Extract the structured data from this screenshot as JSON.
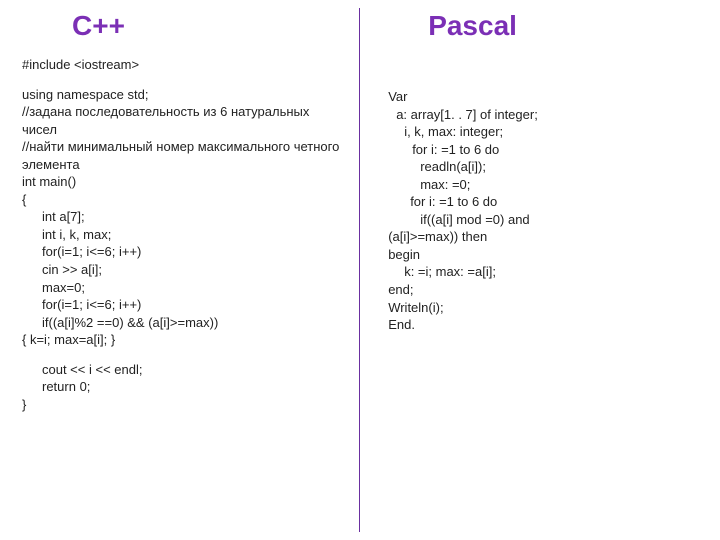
{
  "left": {
    "title": "С++",
    "include": "#include <iostream>",
    "ns": "using namespace std;",
    "c1": "//задана последовательность из 6 натуральных чисел",
    "c2": "//найти минимальный  номер максимального четного элемента",
    "l_main": "int main()",
    "l_ob": "{",
    "l_arr": "int a[7];",
    "l_vars": "int i, k, max;",
    "l_for1": "for(i=1; i<=6; i++)",
    "l_cin": "cin >> a[i];",
    "l_max0": "max=0;",
    "l_for2": "for(i=1; i<=6; i++)",
    "l_if": "if((a[i]%2 ==0) && (a[i]>=max))",
    "l_body": "{ k=i; max=a[i]; }",
    "l_cout": "cout << i << endl;",
    "l_ret": "return 0;",
    "l_cb": "}"
  },
  "right": {
    "title": "Pascal",
    "l_var": "Var",
    "l_a": "a: array[1. . 7] of integer;",
    "l_ikm": "i, k, max: integer;",
    "l_for1": "for i: =1 to 6 do",
    "l_read": "readln(a[i]);",
    "l_max0": "max: =0;",
    "l_for2": "for i: =1 to 6 do",
    "l_if1": "if((a[i] mod =0) and",
    "l_if2": "(a[i]>=max)) then",
    "l_begin": "begin",
    "l_body": "k: =i; max: =a[i];",
    "l_end": "end;",
    "l_write": "Writeln(i);",
    "l_end2": "End."
  }
}
